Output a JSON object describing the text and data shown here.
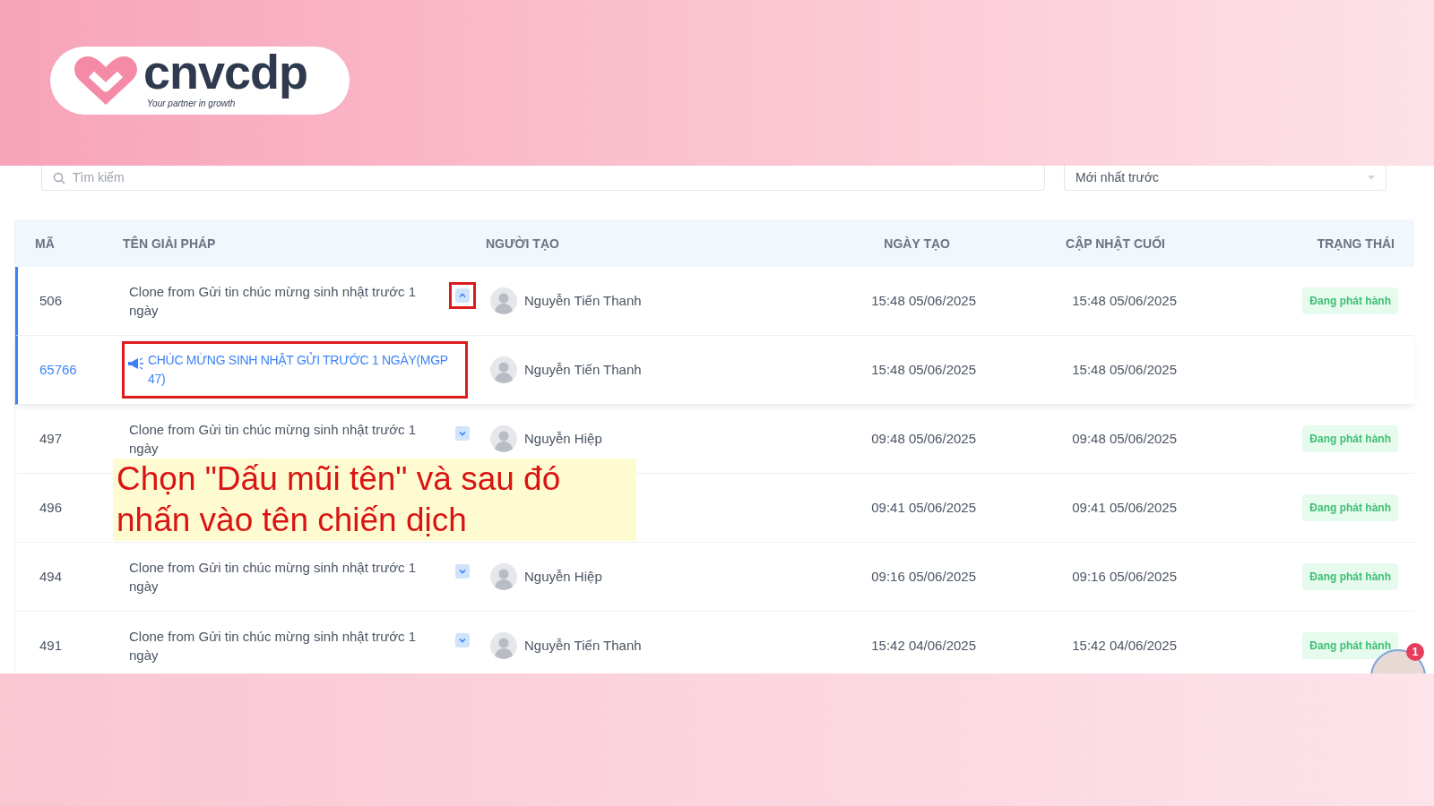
{
  "logo": {
    "name": "cnvcdp",
    "tagline": "Your partner in growth"
  },
  "search": {
    "placeholder": "Tìm kiếm"
  },
  "sort": {
    "value": "Mới nhất trước"
  },
  "table": {
    "columns": [
      "MÃ",
      "TÊN GIẢI PHÁP",
      "NGƯỜI TẠO",
      "NGÀY TẠO",
      "CẬP NHẬT CUỐI",
      "TRẠNG THÁI"
    ],
    "rows": [
      {
        "kind": "parent",
        "id": "506",
        "name": "Clone from Gửi tin chúc mừng sinh nhật trước 1 ngày",
        "expanded": true,
        "highlighted": true,
        "creator": "Nguyễn Tiến Thanh",
        "created": "15:48 05/06/2025",
        "updated": "15:48 05/06/2025",
        "status": "Đang phát hành"
      },
      {
        "kind": "child",
        "id": "65766",
        "name": "CHÚC MỪNG SINH NHẬT GỬI TRƯỚC 1 NGÀY(MGP 47)",
        "highlighted": true,
        "creator": "Nguyễn Tiến Thanh",
        "created": "15:48 05/06/2025",
        "updated": "15:48 05/06/2025"
      },
      {
        "kind": "parent",
        "id": "497",
        "name": "Clone from Gửi tin chúc mừng sinh nhật trước 1 ngày",
        "expanded": false,
        "highlighted": false,
        "creator": "Nguyễn Hiệp",
        "created": "09:48 05/06/2025",
        "updated": "09:48 05/06/2025",
        "status": "Đang phát hành"
      },
      {
        "kind": "covered",
        "id": "496",
        "created": "09:41 05/06/2025",
        "updated": "09:41 05/06/2025",
        "status": "Đang phát hành"
      },
      {
        "kind": "parent",
        "id": "494",
        "name": "Clone from Gửi tin chúc mừng sinh nhật trước 1 ngày",
        "expanded": false,
        "highlighted": false,
        "creator": "Nguyễn Hiệp",
        "created": "09:16 05/06/2025",
        "updated": "09:16 05/06/2025",
        "status": "Đang phát hành"
      },
      {
        "kind": "parent",
        "id": "491",
        "name": "Clone from Gửi tin chúc mừng sinh nhật trước 1 ngày",
        "expanded": false,
        "highlighted": false,
        "creator": "Nguyễn Tiến Thanh",
        "created": "15:42 04/06/2025",
        "updated": "15:42 04/06/2025",
        "status": "Đang phát hành"
      }
    ]
  },
  "annotation": {
    "text": "Chọn \"Dấu mũi tên\" và sau đó nhấn vào tên chiến dịch"
  },
  "chat": {
    "badge": "1"
  }
}
